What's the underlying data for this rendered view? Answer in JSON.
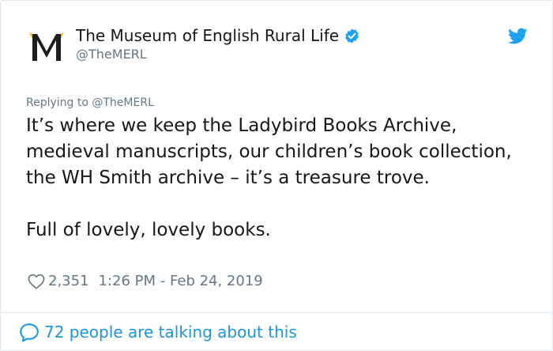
{
  "account": {
    "display_name": "The Museum of English Rural Life",
    "handle": "@TheMERL",
    "verified": true,
    "avatar_icon": "merl-logo-m"
  },
  "tweet": {
    "replying_to": "Replying to @TheMERL",
    "paragraphs": [
      "It’s where we keep the Ladybird Books Archive, medieval manuscripts, our children’s book collection, the WH Smith archive – it’s a treasure trove.",
      "Full of lovely, lovely books."
    ],
    "likes": "2,351",
    "timestamp": "1:26 PM - Feb 24, 2019"
  },
  "footer": {
    "conversation_label": "72 people are talking about this"
  },
  "icons": {
    "brand": "twitter-bird-icon",
    "verified": "verified-badge-icon",
    "like": "heart-icon",
    "conversation": "speech-bubble-icon"
  },
  "colors": {
    "twitter_blue": "#1da1f2",
    "link_blue": "#1b95e0",
    "muted_text": "#657786",
    "primary_text": "#14171a",
    "border": "#e1e8ed",
    "logo_gold": "#f2b61b",
    "logo_dark": "#1d1d1b"
  }
}
